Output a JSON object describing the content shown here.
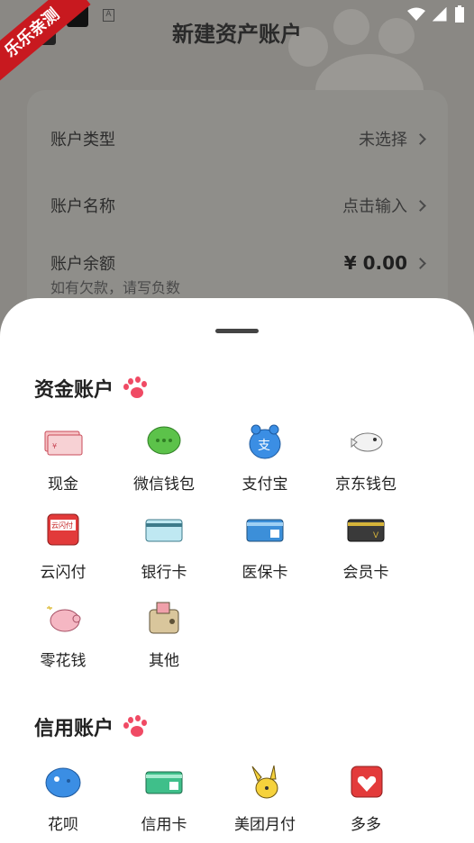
{
  "watermark": "乐乐亲测",
  "header": {
    "title": "新建资产账户"
  },
  "form": {
    "type": {
      "label": "账户类型",
      "value": "未选择"
    },
    "name": {
      "label": "账户名称",
      "value": "点击输入"
    },
    "balance": {
      "label": "账户余额",
      "hint": "如有欠款，请写负数",
      "value": "¥ 0.00"
    }
  },
  "sheet": {
    "sections": [
      {
        "title": "资金账户",
        "items": [
          {
            "label": "现金",
            "icon": "cash-icon"
          },
          {
            "label": "微信钱包",
            "icon": "wechat-icon"
          },
          {
            "label": "支付宝",
            "icon": "alipay-icon"
          },
          {
            "label": "京东钱包",
            "icon": "jd-icon"
          },
          {
            "label": "云闪付",
            "icon": "unionpay-icon"
          },
          {
            "label": "银行卡",
            "icon": "bank-card-icon"
          },
          {
            "label": "医保卡",
            "icon": "medical-card-icon"
          },
          {
            "label": "会员卡",
            "icon": "member-card-icon"
          },
          {
            "label": "零花钱",
            "icon": "piggy-bank-icon"
          },
          {
            "label": "其他",
            "icon": "wallet-icon"
          }
        ]
      },
      {
        "title": "信用账户",
        "items": [
          {
            "label": "花呗",
            "icon": "huabei-icon"
          },
          {
            "label": "信用卡",
            "icon": "credit-card-icon"
          },
          {
            "label": "美团月付",
            "icon": "meituan-icon"
          },
          {
            "label": "多多",
            "icon": "pdd-icon"
          }
        ]
      }
    ]
  },
  "colors": {
    "accent": "#f04a64",
    "sheet_bg": "#ffffff",
    "dim_bg": "#8a8884"
  }
}
